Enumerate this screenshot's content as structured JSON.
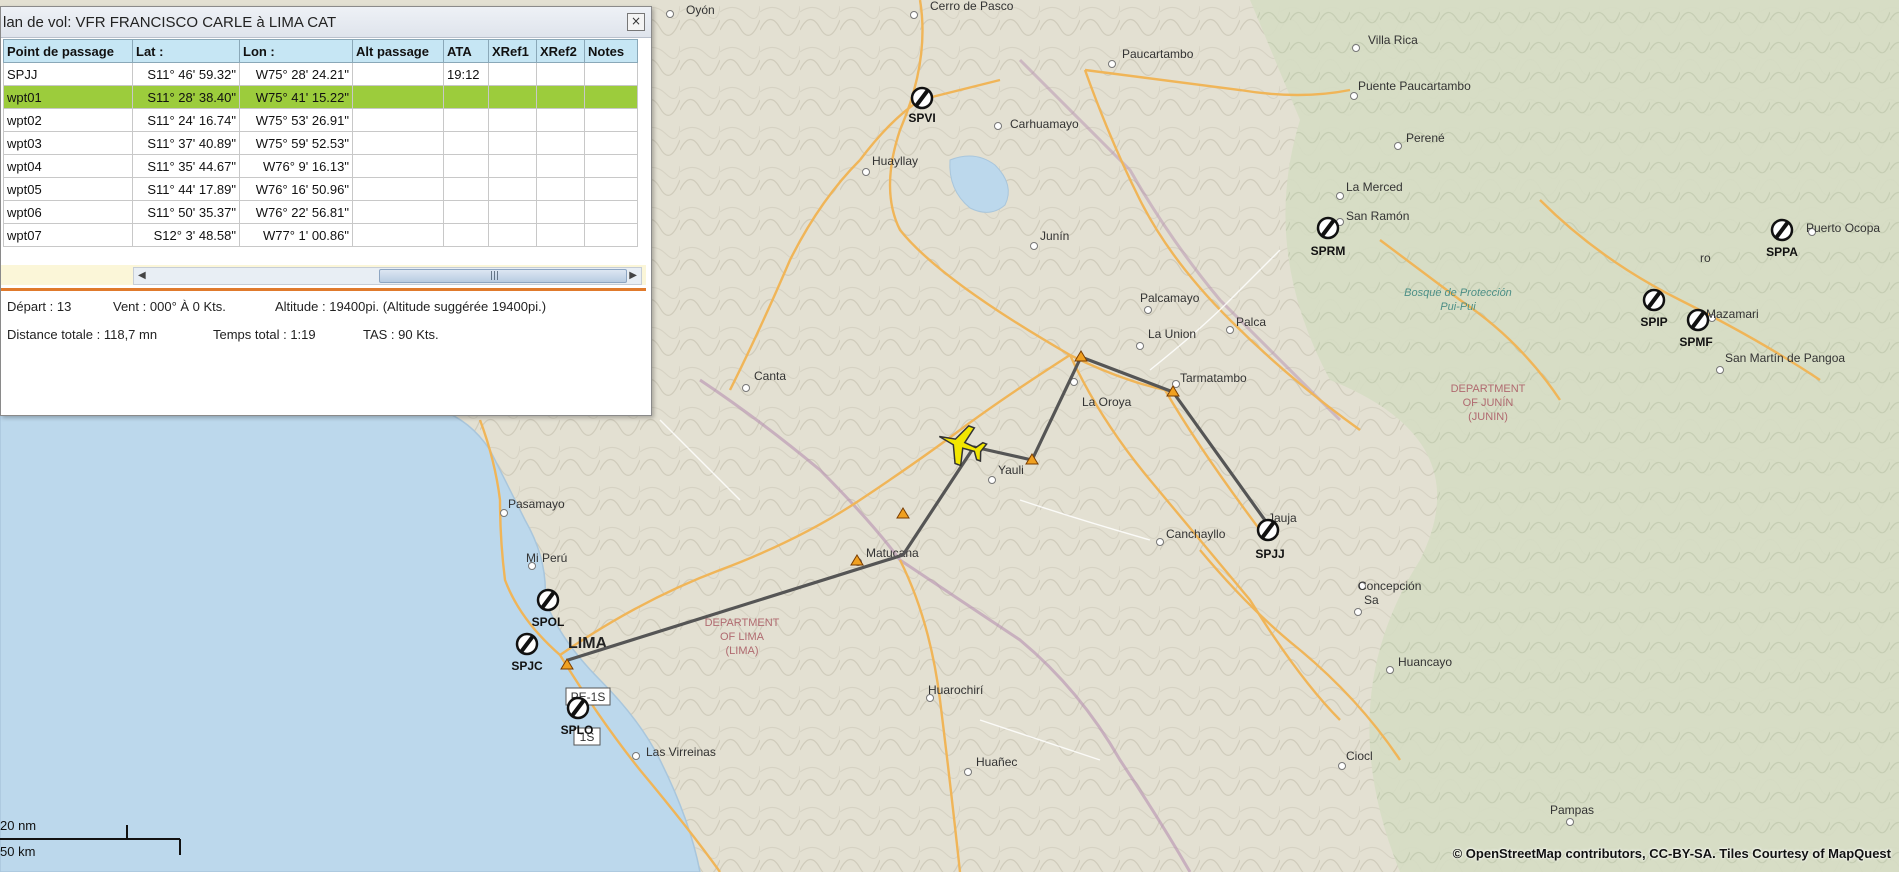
{
  "window": {
    "title": "lan de vol: VFR FRANCISCO CARLE à LIMA CAT",
    "close_glyph": "×"
  },
  "table": {
    "columns": [
      "Point de passage",
      "Lat :",
      "Lon :",
      "Alt passage",
      "ATA",
      "XRef1",
      "XRef2",
      "Notes"
    ],
    "rows": [
      {
        "name": "SPJJ",
        "lat": "S11° 46' 59.32\"",
        "lon": "W75° 28' 24.21\"",
        "alt": "",
        "ata": "19:12",
        "xref1": "",
        "xref2": "",
        "notes": ""
      },
      {
        "name": "wpt01",
        "lat": "S11° 28' 38.40\"",
        "lon": "W75° 41' 15.22\"",
        "alt": "",
        "ata": "",
        "xref1": "",
        "xref2": "",
        "notes": ""
      },
      {
        "name": "wpt02",
        "lat": "S11° 24' 16.74\"",
        "lon": "W75° 53' 26.91\"",
        "alt": "",
        "ata": "",
        "xref1": "",
        "xref2": "",
        "notes": ""
      },
      {
        "name": "wpt03",
        "lat": "S11° 37' 40.89\"",
        "lon": "W75° 59' 52.53\"",
        "alt": "",
        "ata": "",
        "xref1": "",
        "xref2": "",
        "notes": ""
      },
      {
        "name": "wpt04",
        "lat": "S11° 35' 44.67\"",
        "lon": "W76° 9' 16.13\"",
        "alt": "",
        "ata": "",
        "xref1": "",
        "xref2": "",
        "notes": ""
      },
      {
        "name": "wpt05",
        "lat": "S11° 44' 17.89\"",
        "lon": "W76° 16' 50.96\"",
        "alt": "",
        "ata": "",
        "xref1": "",
        "xref2": "",
        "notes": ""
      },
      {
        "name": "wpt06",
        "lat": "S11° 50' 35.37\"",
        "lon": "W76° 22' 56.81\"",
        "alt": "",
        "ata": "",
        "xref1": "",
        "xref2": "",
        "notes": ""
      },
      {
        "name": "wpt07",
        "lat": "S12° 3' 48.58\"",
        "lon": "W77° 1' 00.86\"",
        "alt": "",
        "ata": "",
        "xref1": "",
        "xref2": "",
        "notes": ""
      }
    ],
    "selected_row": 1
  },
  "scrollbar": {
    "left_arrow": "◀",
    "right_arrow": "▶",
    "grip": "|||"
  },
  "info": {
    "depart_label": "Départ :",
    "depart_value": "13",
    "vent_label": "Vent :",
    "vent_value": "000° À 0 Kts.",
    "altitude_label": "Altitude :",
    "altitude_value": "19400pi. (Altitude suggérée 19400pi.)",
    "distance_label": "Distance totale :",
    "distance_value": "118,7 mn",
    "temps_label": "Temps total :",
    "temps_value": "1:19",
    "tas_label": "TAS :",
    "tas_value": "90 Kts."
  },
  "map": {
    "places": [
      "Oyón",
      "Cerro de Pasco",
      "Villa Rica",
      "Paucartambo",
      "Puente Paucartambo",
      "Carhuamayo",
      "Huayllay",
      "Perené",
      "La Merced",
      "San Ramón",
      "Junín",
      "Puerto Ocopa",
      "Palcamayo",
      "Palca",
      "La Union",
      "Mazamari",
      "San Martín de Pangoa",
      "Tarmatambo",
      "Canta",
      "La Oroya",
      "Yauli",
      "Pasamayo",
      "Jauja",
      "Canchayllo",
      "Matucana",
      "Mi Perú",
      "Concepción",
      "Sa",
      "Huancayo",
      "Huarochirí",
      "Las Virreinas",
      "Huañec",
      "Ciocl",
      "Pampas",
      "ro"
    ],
    "airports": [
      "SPVI",
      "SPRM",
      "SPPA",
      "SPIP",
      "SPMF",
      "SPJJ",
      "SPOL",
      "SPJC",
      "SPLO"
    ],
    "city": "LIMA",
    "dept_junin": [
      "DEPARTMENT",
      "OF JUNÍN",
      "(JUNIN)"
    ],
    "dept_lima": [
      "DEPARTMENT",
      "OF LIMA",
      "(LIMA)"
    ],
    "park": [
      "Bosque de Protección",
      "Pui-Pui"
    ],
    "road_shields": [
      "PE-1S",
      "1S"
    ],
    "colors": {
      "route": "#555555",
      "waypoint": "#f0a020",
      "aircraft": "#f2e600",
      "road": "#f0b558",
      "water": "#bcd8ec"
    }
  },
  "scale": {
    "nm": "20 nm",
    "km": "50 km"
  },
  "attribution": "© OpenStreetMap contributors, CC-BY-SA. Tiles Courtesy of MapQuest"
}
